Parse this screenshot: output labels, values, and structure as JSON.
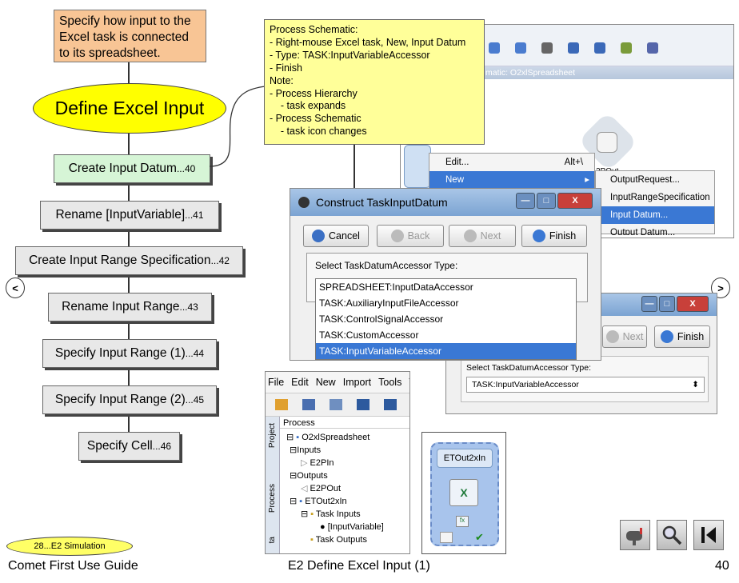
{
  "intro_note": "Specify how input to the Excel task is connected to its spreadsheet.",
  "main_step": "Define Excel Input",
  "steps": [
    {
      "label": "Create Input Datum",
      "page": "...40"
    },
    {
      "label": "Rename [InputVariable]",
      "page": "...41"
    },
    {
      "label": "Create Input Range Specification",
      "page": "...42"
    },
    {
      "label": "Rename Input Range",
      "page": "...43"
    },
    {
      "label": "Specify Input Range (1)",
      "page": "...44"
    },
    {
      "label": "Specify Input Range (2)",
      "page": "...45"
    },
    {
      "label": "Specify Cell",
      "page": "...46"
    }
  ],
  "nav": {
    "prev": "<",
    "next": ">"
  },
  "callout": "Process Schematic:\n- Right-mouse Excel task, New, Input Datum\n- Type: TASK:InputVariableAccessor\n- Finish\nNote:\n- Process Hierarchy\n    - task expands\n- Process Schematic\n    - task icon changes",
  "schematic": {
    "title": "matic: O2xlSpreadsheet",
    "node_label": "2POut",
    "context_menu": [
      {
        "label": "Edit...",
        "shortcut": "Alt+\\"
      },
      {
        "label": "New",
        "shortcut": "▸"
      }
    ],
    "submenu": [
      "OutputRequest...",
      "InputRangeSpecification",
      "Input Datum...",
      "Output Datum..."
    ]
  },
  "dialog_front": {
    "title": "Construct TaskInputDatum",
    "buttons": {
      "cancel": "Cancel",
      "back": "Back",
      "next": "Next",
      "finish": "Finish"
    },
    "select_label": "Select TaskDatumAccessor Type:",
    "options": [
      "SPREADSHEET:InputDataAccessor",
      "TASK:AuxiliaryInputFileAccessor",
      "TASK:ControlSignalAccessor",
      "TASK:CustomAccessor",
      "TASK:InputVariableAccessor"
    ],
    "selected": "TASK:InputVariableAccessor"
  },
  "dialog_back": {
    "buttons": {
      "next": "Next",
      "finish": "Finish"
    },
    "select_label": "Select TaskDatumAccessor Type:",
    "selected_value": "TASK:InputVariableAccessor"
  },
  "hierarchy": {
    "menu": [
      "File",
      "Edit",
      "New",
      "Import",
      "Tools",
      "V"
    ],
    "panel_title": "Process",
    "side_tabs": [
      "Project",
      "Process",
      "ta"
    ],
    "tree": [
      {
        "label": "O2xlSpreadsheet",
        "indent": 0
      },
      {
        "label": "Inputs",
        "indent": 1
      },
      {
        "label": "E2PIn",
        "indent": 2
      },
      {
        "label": "Outputs",
        "indent": 1
      },
      {
        "label": "E2POut",
        "indent": 2
      },
      {
        "label": "ETOut2xIn",
        "indent": 1
      },
      {
        "label": "Task Inputs",
        "indent": 2
      },
      {
        "label": "[InputVariable]",
        "indent": 3
      },
      {
        "label": "Task Outputs",
        "indent": 2
      }
    ]
  },
  "task_icon": {
    "label": "ETOut2xIn"
  },
  "badge": "28...E2 Simulation",
  "footer": {
    "left": "Comet First Use Guide",
    "center": "E2 Define Excel Input (1)",
    "page": "40"
  },
  "colors": {
    "note_orange": "#f8c595",
    "ellipse_yellow": "#ffff00",
    "callout_yellow": "#ffff99",
    "selection_blue": "#3a78d4",
    "current_step_green": "#d6f5d6"
  }
}
